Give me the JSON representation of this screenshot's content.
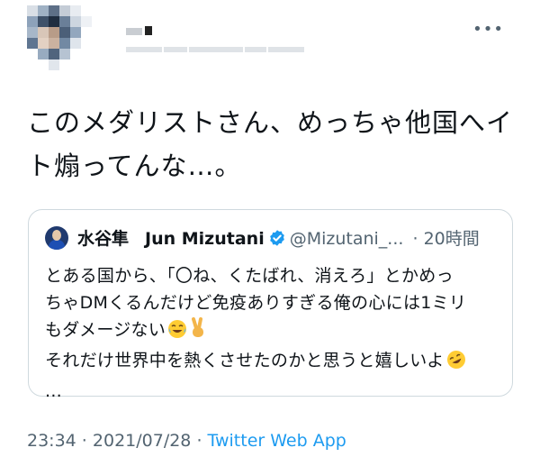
{
  "author": {
    "avatar": "pixelated-avatar",
    "name": "",
    "handle": ""
  },
  "more_icon": "more-icon",
  "tweet": {
    "line1": "このメダリストさん、めっちゃ他国へイ",
    "line2": "ト煽ってんな…。"
  },
  "quote": {
    "name": "水谷隼",
    "display_name": "Jun Mizutani",
    "handle": "@Mizutani_...",
    "time": "· 20時間",
    "lines": [
      "とある国から、「〇ね、くたばれ、消えろ」とかめっ",
      "ちゃDMくるんだけど免疫ありすぎる俺の心には1ミリ",
      "もダメージない",
      "それだけ世界中を熱くさせたのかと思うと嬉しいよ",
      "..."
    ],
    "emojis": [
      "tears-of-joy-icon",
      "victory-hand-icon",
      "rofl-icon"
    ]
  },
  "meta": {
    "time": "23:34",
    "separator1": " · ",
    "date": "2021/07/28",
    "separator2": " · ",
    "source": "Twitter Web App"
  },
  "colors": {
    "text": "#0f1419",
    "secondary": "#536471",
    "link": "#1d9bf0",
    "border": "#cfd9de",
    "verified": "#1d9bf0"
  }
}
